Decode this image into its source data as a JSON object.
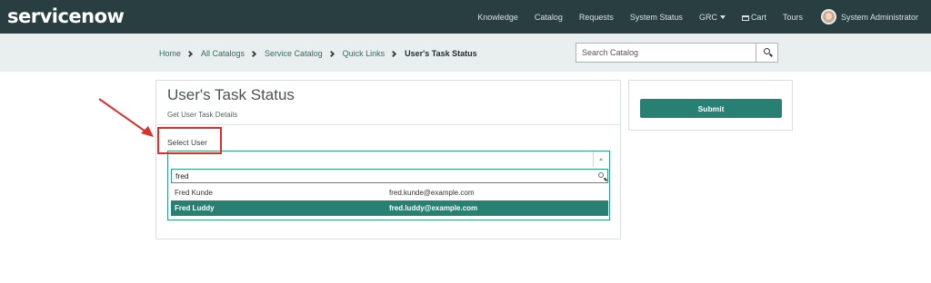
{
  "header": {
    "logo_text": "servicenow",
    "nav": {
      "knowledge": "Knowledge",
      "catalog": "Catalog",
      "requests": "Requests",
      "system_status": "System Status",
      "grc": "GRC",
      "cart": "Cart",
      "tours": "Tours"
    },
    "user_name": "System Administrator"
  },
  "breadcrumb": [
    "Home",
    "All Catalogs",
    "Service Catalog",
    "Quick Links",
    "User's Task Status"
  ],
  "search": {
    "placeholder": "Search Catalog"
  },
  "form": {
    "title": "User's Task Status",
    "subtitle": "Get User Task Details",
    "field_label": "Select User",
    "select_value": "",
    "dropdown_search_value": "fred",
    "options": [
      {
        "name": "Fred Kunde",
        "email": "fred.kunde@example.com",
        "selected": false
      },
      {
        "name": "Fred Luddy",
        "email": "fred.luddy@example.com",
        "selected": true
      }
    ]
  },
  "actions": {
    "submit_label": "Submit"
  },
  "colors": {
    "header_bg": "#293e40",
    "accent": "#278071",
    "annotation_red": "#d9302b"
  },
  "icons": {
    "catalog_search": "search-icon",
    "dropdown_search": "search-icon",
    "select_toggle": "chevron-up-icon",
    "cart": "cart-icon",
    "grc_menu": "caret-down-icon"
  }
}
